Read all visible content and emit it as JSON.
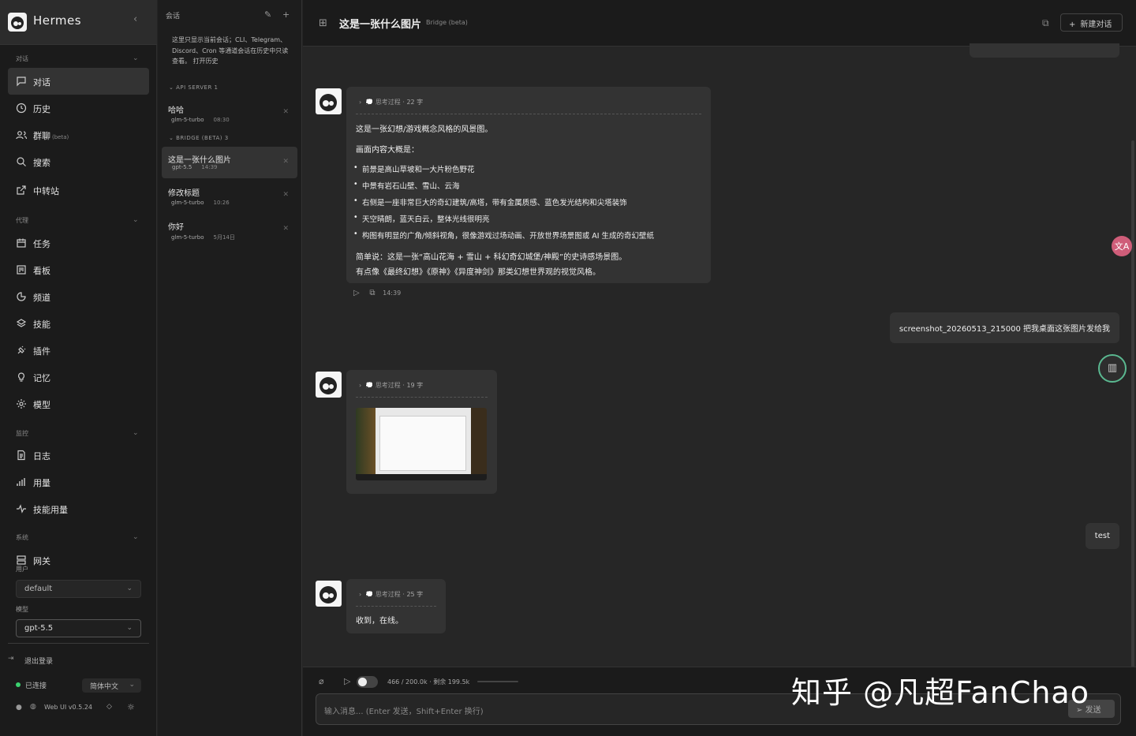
{
  "brand": {
    "name": "Hermes",
    "collapse": "‹"
  },
  "sidebar": {
    "sec_chat": "对话",
    "chat_items": [
      {
        "label": "对话"
      },
      {
        "label": "历史"
      },
      {
        "label": "群聊",
        "beta": "(beta)"
      },
      {
        "label": "搜索"
      },
      {
        "label": "中转站"
      }
    ],
    "sec_agent": "代理",
    "agent_items": [
      {
        "label": "任务"
      },
      {
        "label": "看板"
      },
      {
        "label": "频道"
      },
      {
        "label": "技能"
      },
      {
        "label": "插件"
      },
      {
        "label": "记忆"
      },
      {
        "label": "模型"
      }
    ],
    "sec_monitor": "监控",
    "monitor_items": [
      {
        "label": "日志"
      },
      {
        "label": "用量"
      },
      {
        "label": "技能用量"
      }
    ],
    "sec_system": "系统",
    "system_items": [
      {
        "label": "网关"
      }
    ],
    "user_label": "用户",
    "user_value": "default",
    "model_label": "模型",
    "model_value": "gpt-5.5",
    "logout": "退出登录",
    "status": "已连接",
    "language": "简体中文",
    "version": "Web UI v0.5.24"
  },
  "sessions": {
    "title": "会话",
    "note": "这里只显示当前会话；CLI、Telegram、Discord、Cron 等通道会话在历史中只读查看。 打开历史",
    "group1": "API SERVER 1",
    "group2": "BRIDGE (BETA) 3",
    "items": [
      {
        "title": "哈哈",
        "model": "glm-5-turbo",
        "time": "08:30"
      },
      {
        "title": "这是一张什么图片",
        "model": "gpt-5.5",
        "time": "14:39"
      },
      {
        "title": "修改标题",
        "model": "glm-5-turbo",
        "time": "10:26"
      },
      {
        "title": "你好",
        "model": "glm-5-turbo",
        "time": "5月14日"
      }
    ]
  },
  "header": {
    "title": "这是一张什么图片",
    "subtitle": "Bridge (beta)",
    "new_chat": "新建对话"
  },
  "messages": {
    "m1": {
      "think_label": "思考过程",
      "think_count": "· 22 字",
      "line1": "这是一张幻想/游戏概念风格的风景图。",
      "line2": "画面内容大概是：",
      "bullets": [
        "前景是高山草坡和一大片粉色野花",
        "中景有岩石山壁、雪山、云海",
        "右侧是一座非常巨大的奇幻建筑/高塔，带有金属质感、蓝色发光结构和尖塔装饰",
        "天空晴朗，蓝天白云，整体光线很明亮",
        "构图有明显的广角/倾斜视角，很像游戏过场动画、开放世界场景图或 AI 生成的奇幻壁纸"
      ],
      "summary1": "简单说：这是一张“高山花海 + 雪山 + 科幻奇幻城堡/神殿”的史诗感场景图。",
      "summary2": "有点像《最终幻想》《原神》《异度神剑》那类幻想世界观的视觉风格。",
      "time": "14:39"
    },
    "u1": "screenshot_20260513_215000 把我桌面这张图片发给我",
    "m2": {
      "think_label": "思考过程",
      "think_count": "· 19 字"
    },
    "u2": "test",
    "m3": {
      "think_label": "思考过程",
      "think_count": "· 25 字",
      "text": "收到，在线。"
    }
  },
  "composer": {
    "tokens": "466 / 200.0k · 剩余 199.5k",
    "placeholder": "输入消息... (Enter 发送，Shift+Enter 换行)",
    "send": "发送"
  },
  "float": {
    "translate": "文A"
  },
  "watermark": "知乎 @凡超FanChao"
}
